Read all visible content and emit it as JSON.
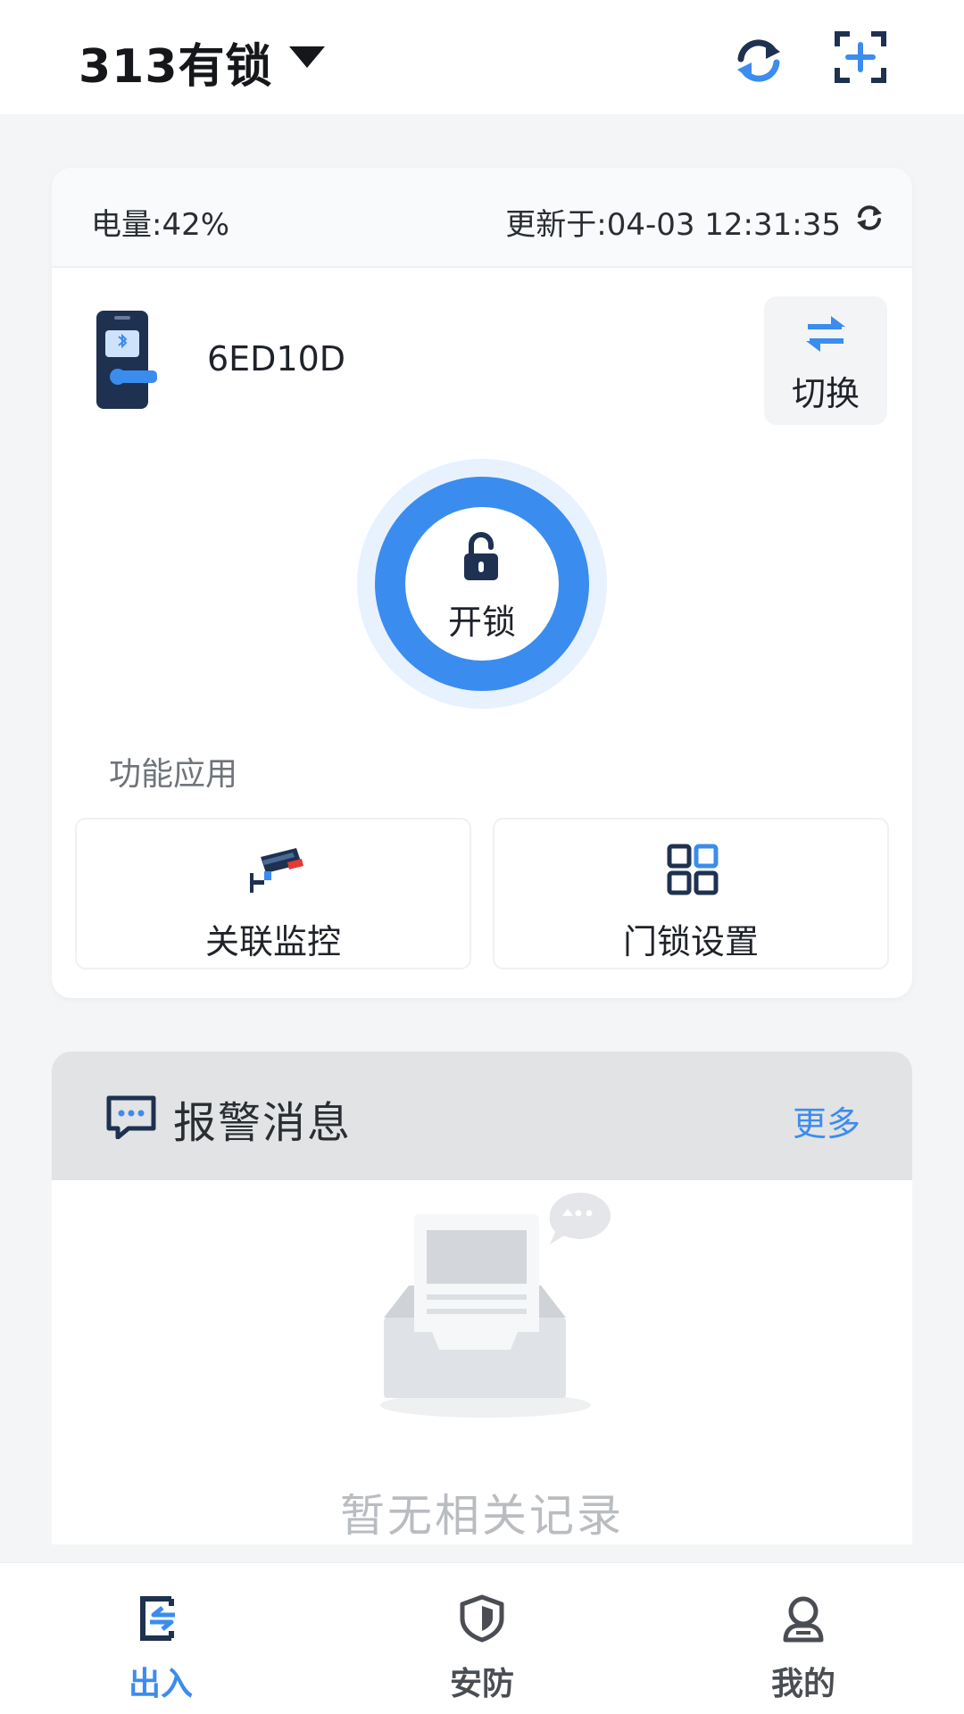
{
  "header": {
    "home_name": "313有锁",
    "icons": {
      "dropdown": "dropdown-triangle-icon",
      "refresh": "refresh-icon",
      "scan": "scan-add-icon"
    }
  },
  "status": {
    "battery": "电量:42%",
    "battery_percent": 42,
    "updated": "更新于:04-03 12:31:35"
  },
  "device": {
    "name": "6ED10D",
    "switch_label": "切换",
    "unlock_label": "开锁"
  },
  "functions": {
    "title": "功能应用",
    "items": [
      {
        "label": "关联监控",
        "icon": "camera-icon"
      },
      {
        "label": "门锁设置",
        "icon": "grid-icon"
      }
    ]
  },
  "alarm": {
    "title": "报警消息",
    "more": "更多",
    "empty_text": "暂无相关记录"
  },
  "tabs": [
    {
      "label": "出入",
      "icon": "door-entry-icon",
      "active": true
    },
    {
      "label": "安防",
      "icon": "shield-icon",
      "active": false
    },
    {
      "label": "我的",
      "icon": "person-icon",
      "active": false
    }
  ],
  "colors": {
    "accent": "#3b8cef",
    "navy": "#1e3150",
    "page_bg": "#f4f5f6",
    "empty_text": "#b9bcc0"
  }
}
